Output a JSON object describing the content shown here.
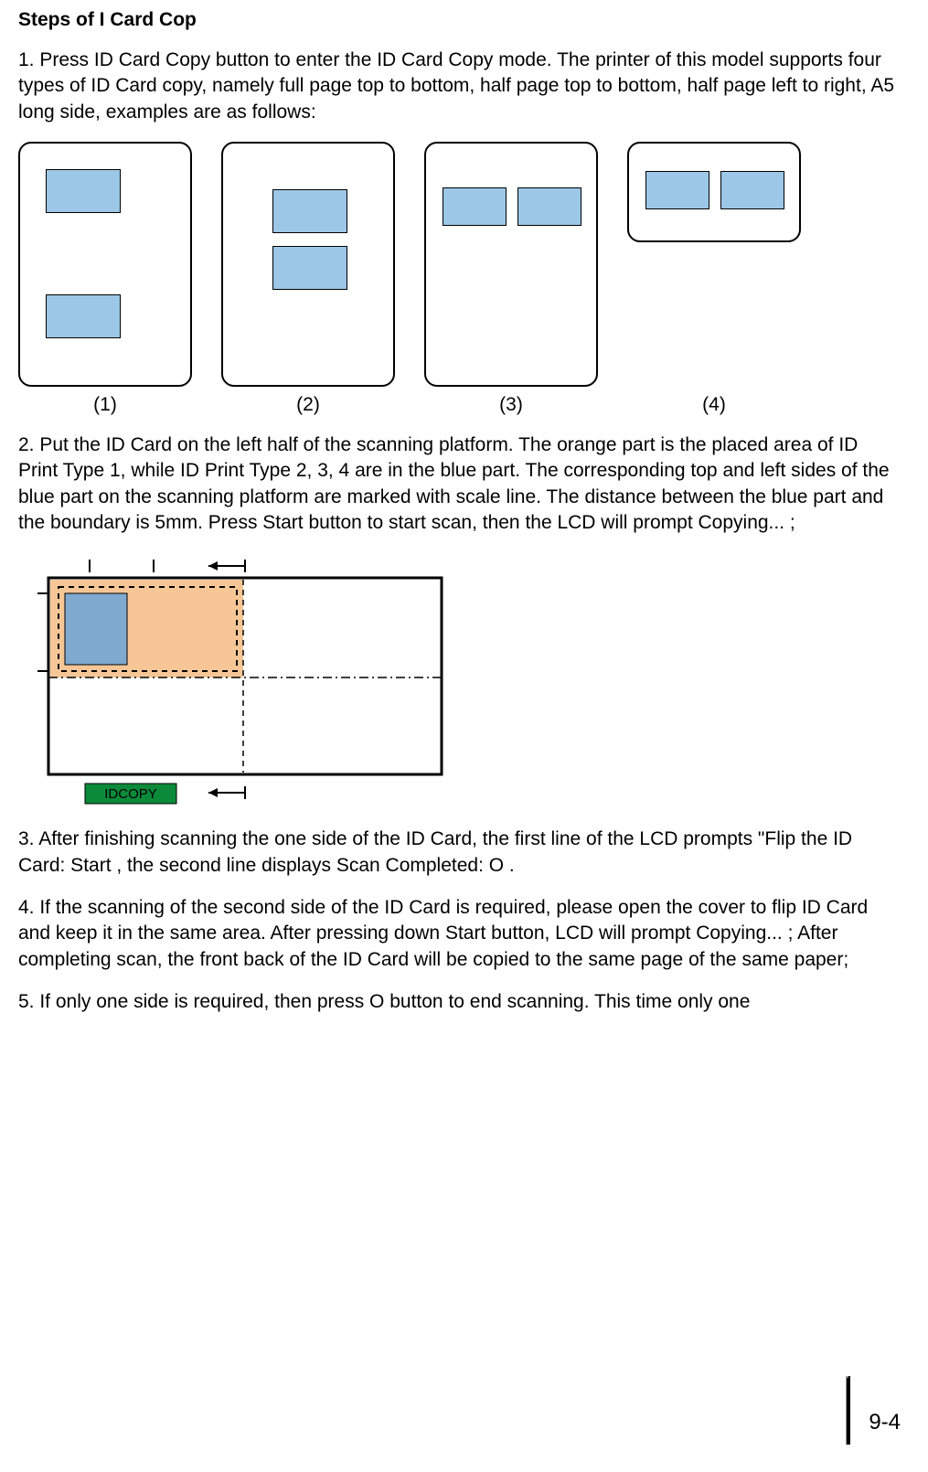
{
  "heading": "Steps of I    Card Cop",
  "para1": "1. Press  ID Card Copy  button to enter the  ID Card Copy  mode. The printer of this model supports four types of ID Card copy, namely full page top to bottom, half page top to bottom, half page left to right, A5 long side, examples are as follows:",
  "captions": {
    "c1": "(1)",
    "c2": "(2)",
    "c3": "(3)",
    "c4": "(4)"
  },
  "para2": "2. Put the ID Card on the left half of the scanning platform. The orange part is the placed area of ID Print Type 1, while ID Print Type 2, 3, 4 are in the blue part. The corresponding top and left sides of the blue part on the scanning platform are marked with scale line. The distance between the blue part and the boundary is 5mm. Press  Start  button to start scan, then the LCD will prompt  Copying... ;",
  "idcopy_label": "IDCOPY",
  "para3": "3. After finishing scanning the one side of the ID Card, the first line of the LCD prompts \"Flip the ID Card: Start , the second line displays  Scan Completed: O    .",
  "para4": "4. If the scanning of the second side of the ID Card is required, please open the cover to flip ID Card and keep it in the same area. After pressing down  Start  button, LCD will prompt  Copying... ; After completing scan, the front back of the ID Card will be copied to the same page of the same paper;",
  "para5": "5. If only one side is required, then press  O     button to end scanning. This time only one",
  "pagenum": "9-4"
}
